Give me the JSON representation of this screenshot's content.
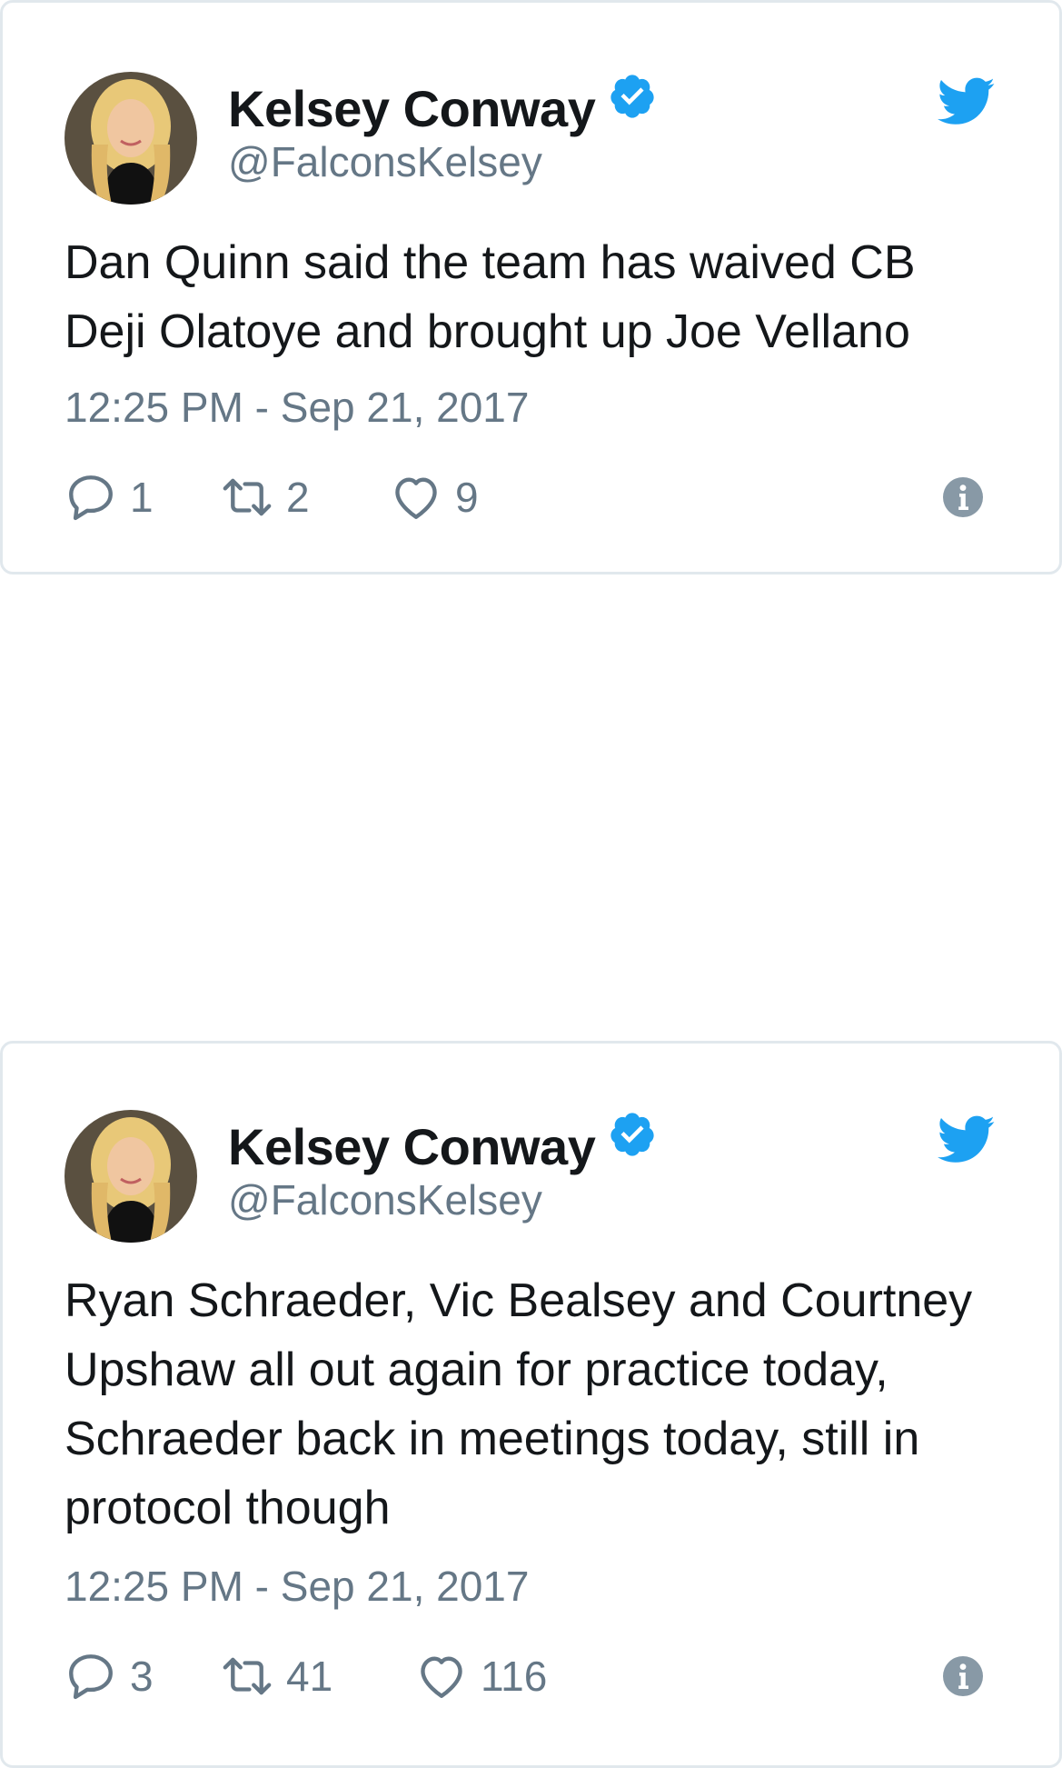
{
  "tweets": [
    {
      "display_name": "Kelsey Conway",
      "handle": "@FalconsKelsey",
      "text": "Dan Quinn said the team has waived CB Deji Olatoye and brought up Joe Vellano",
      "timestamp": "12:25 PM - Sep 21, 2017",
      "replies": "1",
      "retweets": "2",
      "likes": "9"
    },
    {
      "display_name": "Kelsey Conway",
      "handle": "@FalconsKelsey",
      "text": "Ryan Schraeder, Vic Bealsey and Courtney Upshaw all out again for practice today, Schraeder back in meetings today, still in protocol though",
      "timestamp": "12:25 PM - Sep 21, 2017",
      "replies": "3",
      "retweets": "41",
      "likes": "116"
    }
  ],
  "icons": {
    "brand": "twitter-bird-icon",
    "verified": "verified-badge-icon",
    "reply": "reply-icon",
    "retweet": "retweet-icon",
    "like": "heart-icon",
    "info": "info-icon"
  },
  "colors": {
    "brand_blue": "#1da1f2",
    "text": "#14171a",
    "muted": "#657786",
    "border": "#e1e8ed"
  }
}
